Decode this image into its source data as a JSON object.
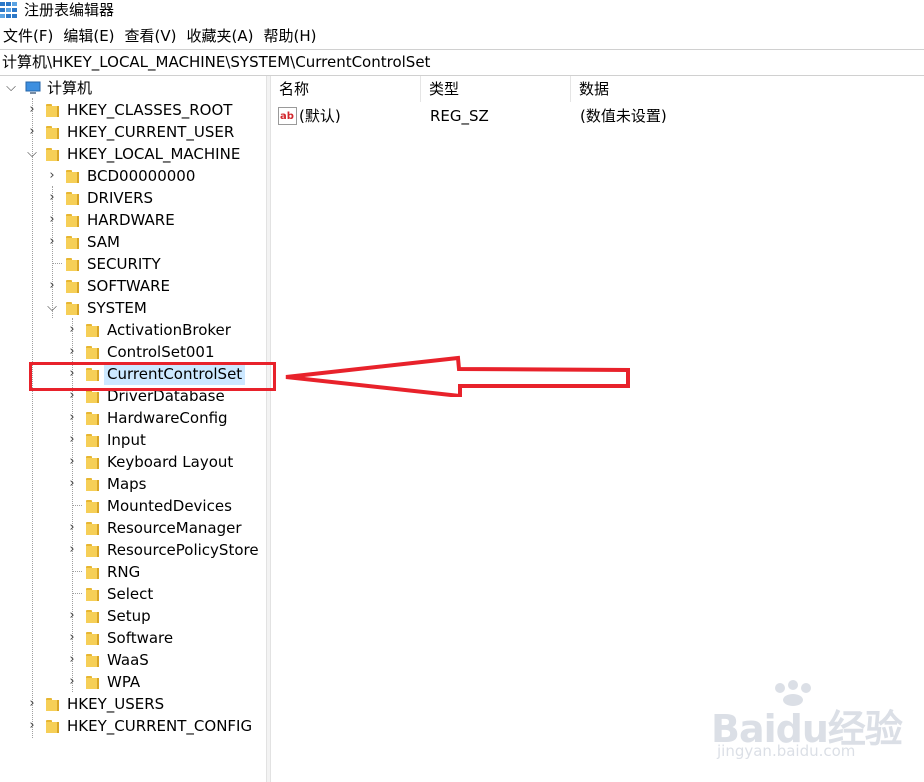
{
  "window": {
    "title": "注册表编辑器"
  },
  "menu": [
    "文件(F)",
    "编辑(E)",
    "查看(V)",
    "收藏夹(A)",
    "帮助(H)"
  ],
  "address": "计算机\\HKEY_LOCAL_MACHINE\\SYSTEM\\CurrentControlSet",
  "tree": {
    "root": "计算机",
    "hives": {
      "classes_root": "HKEY_CLASSES_ROOT",
      "current_user": "HKEY_CURRENT_USER",
      "local_machine": "HKEY_LOCAL_MACHINE",
      "users": "HKEY_USERS",
      "current_config": "HKEY_CURRENT_CONFIG"
    },
    "hklm_children": {
      "bcd": "BCD00000000",
      "drivers": "DRIVERS",
      "hardware": "HARDWARE",
      "sam": "SAM",
      "security": "SECURITY",
      "software": "SOFTWARE",
      "system": "SYSTEM"
    },
    "system_children": {
      "activationbroker": "ActivationBroker",
      "controlset001": "ControlSet001",
      "currentcontrolset": "CurrentControlSet",
      "driverdatabase": "DriverDatabase",
      "hardwareconfig": "HardwareConfig",
      "input": "Input",
      "keyboardlayout": "Keyboard Layout",
      "maps": "Maps",
      "mounteddevices": "MountedDevices",
      "resourcemanager": "ResourceManager",
      "resourcepolicystore": "ResourcePolicyStore",
      "rng": "RNG",
      "select": "Select",
      "setup": "Setup",
      "software": "Software",
      "waas": "WaaS",
      "wpa": "WPA"
    },
    "selected": "CurrentControlSet"
  },
  "list": {
    "columns": {
      "name": "名称",
      "type": "类型",
      "data": "数据"
    },
    "rows": [
      {
        "name": "(默认)",
        "type": "REG_SZ",
        "data": "(数值未设置)",
        "icon": "string-value-icon"
      }
    ]
  },
  "watermark": {
    "main": "Baidu经验",
    "sub": "jingyan.baidu.com"
  },
  "colors": {
    "annotation": "#e8222b",
    "selection": "#cce8ff",
    "folder": "#f6cf57"
  }
}
